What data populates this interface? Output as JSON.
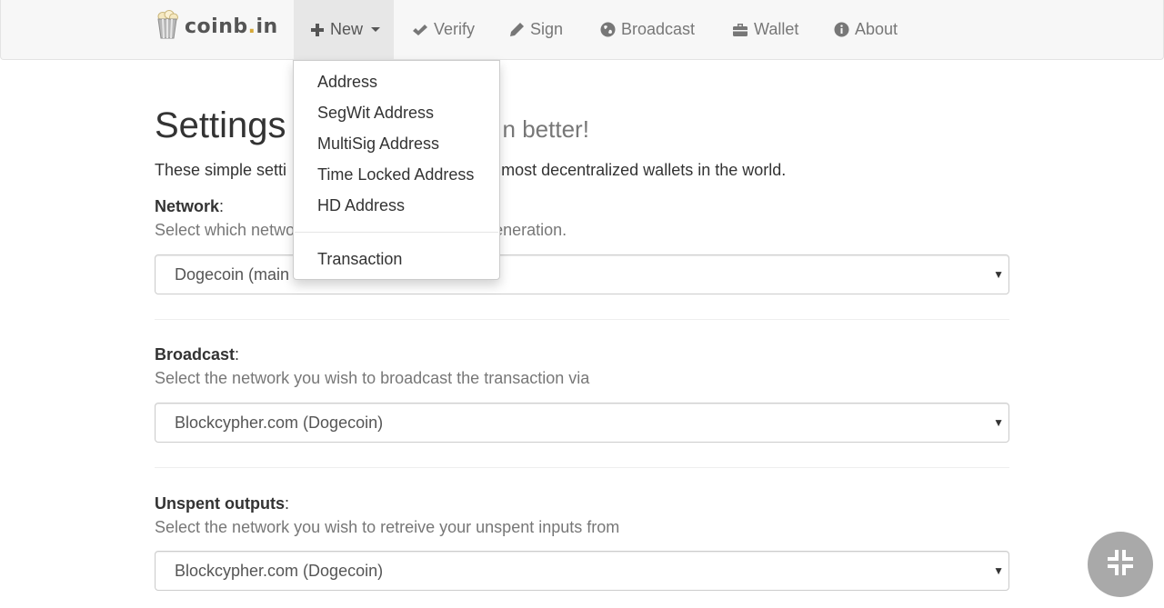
{
  "brand": {
    "name_left": "coinb",
    "name_dot": ".",
    "name_right": "in"
  },
  "nav": {
    "items": [
      {
        "label": "New",
        "icon": "plus-icon"
      },
      {
        "label": "Verify",
        "icon": "check-icon"
      },
      {
        "label": "Sign",
        "icon": "pencil-icon"
      },
      {
        "label": "Broadcast",
        "icon": "globe-icon"
      },
      {
        "label": "Wallet",
        "icon": "briefcase-icon"
      },
      {
        "label": "About",
        "icon": "info-circle-icon"
      }
    ]
  },
  "dropdown": {
    "items": [
      "Address",
      "SegWit Address",
      "MultiSig Address",
      "Time Locked Address",
      "HD Address"
    ],
    "extra_item": "Transaction"
  },
  "page": {
    "title": "Settings",
    "title_small": "n better!",
    "intro": "These simple setti",
    "intro_tail": "e of the most decentralized wallets in the world."
  },
  "sections": {
    "network": {
      "label": "Network",
      "help": "Select which netwo",
      "help_tail": "pair generation.",
      "value": "Dogecoin (main"
    },
    "broadcast": {
      "label": "Broadcast",
      "help": "Select the network you wish to broadcast the transaction via",
      "value": "Blockcypher.com (Dogecoin)"
    },
    "unspent": {
      "label": "Unspent outputs",
      "help": "Select the network you wish to retreive your unspent inputs from",
      "value": "Blockcypher.com (Dogecoin)"
    }
  },
  "colors": {
    "navbar_bg": "#f7f7f7",
    "accent_dot": "#d6a938",
    "fab_bg": "#a9a9a9"
  }
}
